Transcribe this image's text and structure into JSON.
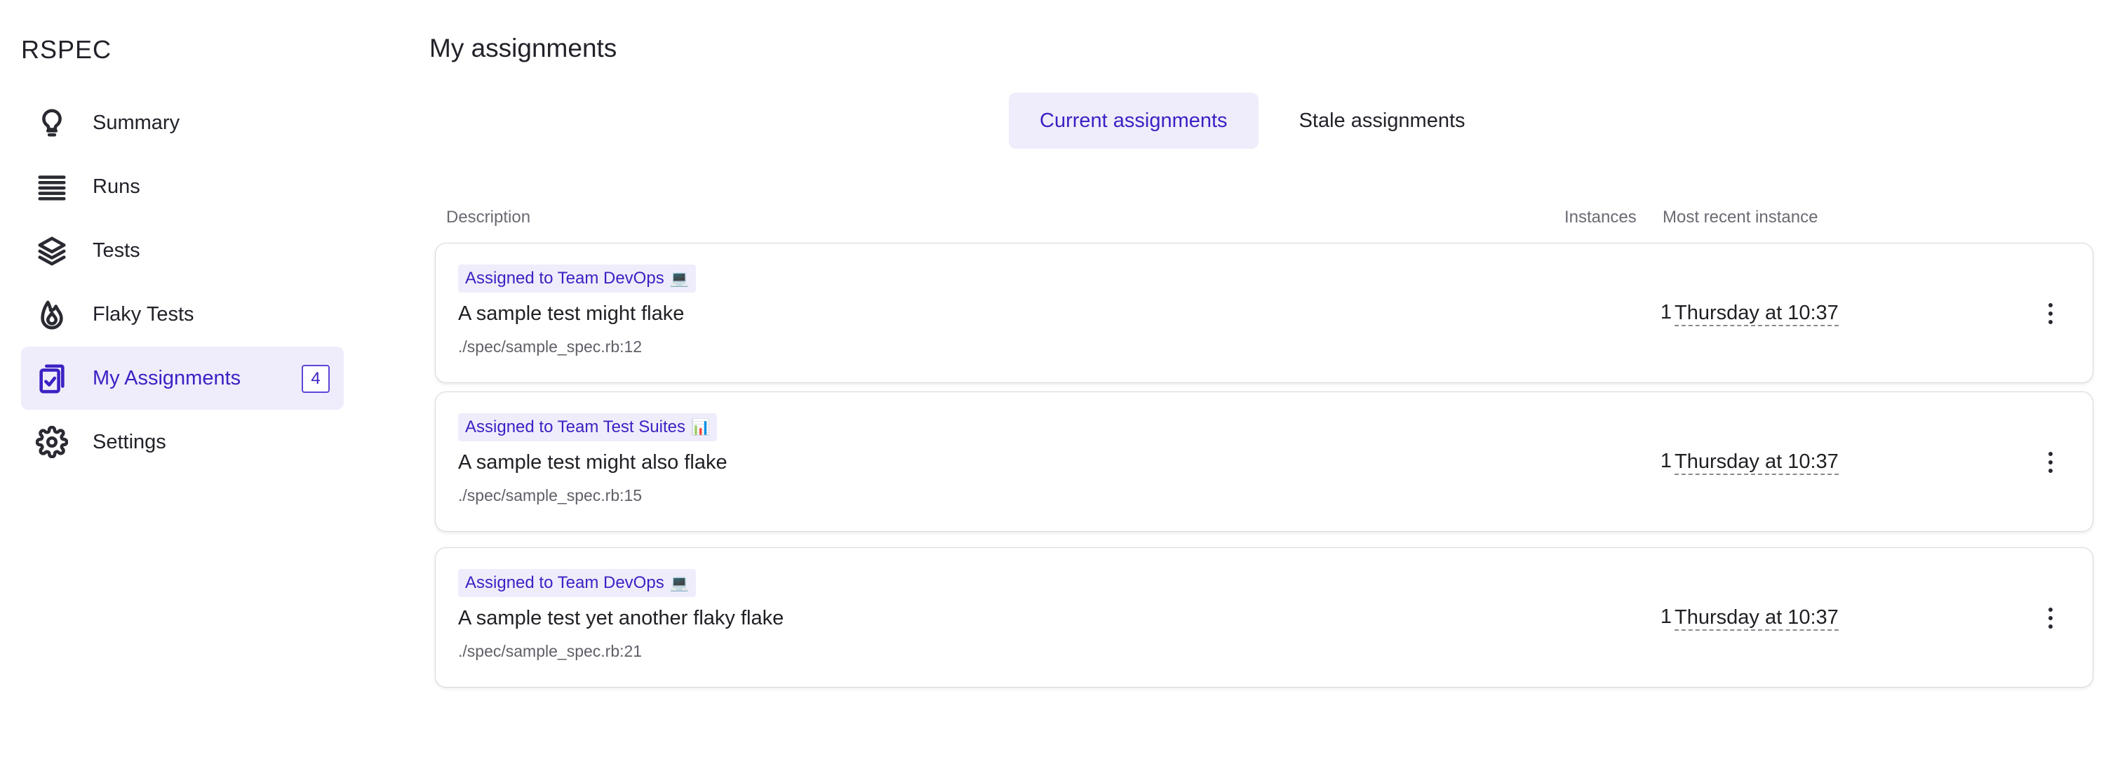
{
  "sidebar": {
    "brand": "RSPEC",
    "items": [
      {
        "label": "Summary",
        "icon": "lightbulb-icon"
      },
      {
        "label": "Runs",
        "icon": "list-lines-icon"
      },
      {
        "label": "Tests",
        "icon": "layers-icon"
      },
      {
        "label": "Flaky Tests",
        "icon": "flame-icon"
      },
      {
        "label": "My Assignments",
        "icon": "clipboard-check-icon",
        "badge": "4",
        "active": true
      },
      {
        "label": "Settings",
        "icon": "gear-icon"
      }
    ]
  },
  "main": {
    "title": "My assignments",
    "tabs": [
      {
        "label": "Current assignments",
        "active": true
      },
      {
        "label": "Stale assignments",
        "active": false
      }
    ],
    "columns": {
      "description": "Description",
      "instances": "Instances",
      "most_recent": "Most recent instance"
    },
    "rows": [
      {
        "assignee": "Assigned to Team DevOps",
        "assignee_emoji": "💻",
        "title": "A sample test might flake",
        "path": "./spec/sample_spec.rb:12",
        "instances": "1",
        "most_recent": "Thursday at 10:37"
      },
      {
        "assignee": "Assigned to Team Test Suites",
        "assignee_emoji": "📊",
        "title": "A sample test might also flake",
        "path": "./spec/sample_spec.rb:15",
        "instances": "1",
        "most_recent": "Thursday at 10:37"
      },
      {
        "assignee": "Assigned to Team DevOps",
        "assignee_emoji": "💻",
        "title": "A sample test yet another flaky flake",
        "path": "./spec/sample_spec.rb:21",
        "instances": "1",
        "most_recent": "Thursday at 10:37"
      }
    ]
  },
  "colors": {
    "accent": "#3b22c4",
    "accent_bg": "#efedfb",
    "border": "#d8d8de",
    "muted_text": "#6a6a72"
  }
}
